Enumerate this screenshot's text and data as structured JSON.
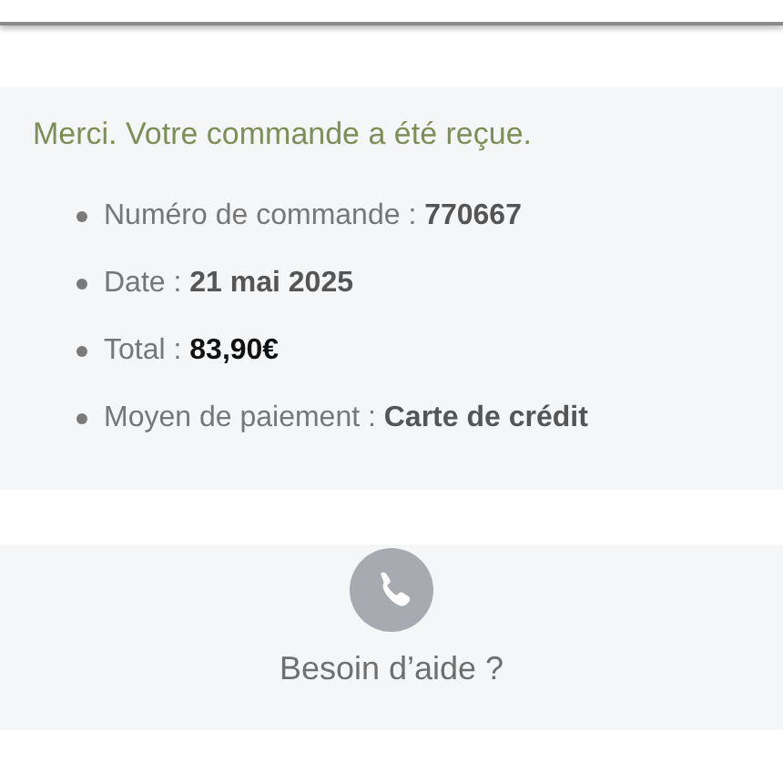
{
  "confirmation": {
    "title": "Merci. Votre commande a été reçue.",
    "details": [
      {
        "text": "Numéro de commande : **770667**",
        "highlight": false
      },
      {
        "text": "Date : **21 mai 2025**",
        "highlight": false
      },
      {
        "text": "Total : **83,90€**",
        "highlight": true
      },
      {
        "text": "Moyen de paiement : **Carte de crédit**",
        "highlight": false
      }
    ]
  },
  "help": {
    "title": "Besoin d’aide ?"
  }
}
